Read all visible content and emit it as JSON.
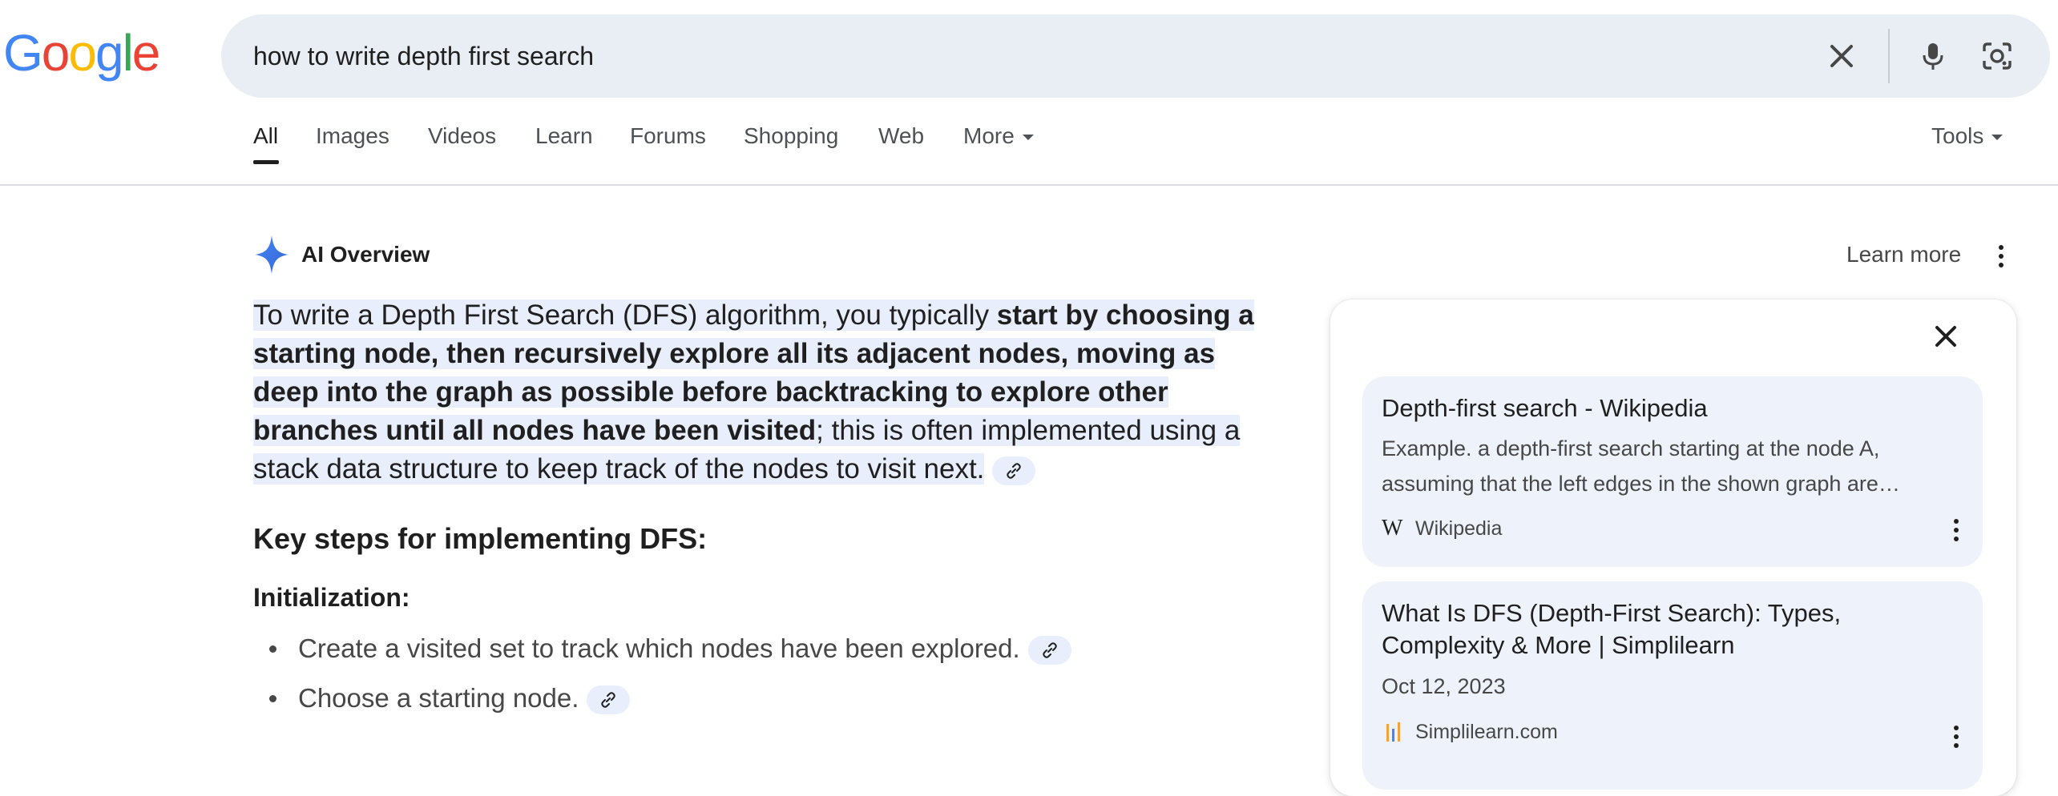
{
  "logo": {
    "letters": [
      "G",
      "o",
      "o",
      "g",
      "l",
      "e"
    ],
    "colors": [
      "#4285F4",
      "#EA4335",
      "#FBBC05",
      "#4285F4",
      "#34A853",
      "#EA4335"
    ]
  },
  "search": {
    "query": "how to write depth first search"
  },
  "tabs": [
    {
      "label": "All",
      "active": true
    },
    {
      "label": "Images"
    },
    {
      "label": "Videos"
    },
    {
      "label": "Learn"
    },
    {
      "label": "Forums"
    },
    {
      "label": "Shopping"
    },
    {
      "label": "Web"
    },
    {
      "label": "More"
    }
  ],
  "tools_label": "Tools",
  "ai_overview": {
    "title": "AI Overview",
    "learn_more": "Learn more",
    "answer_prefix": "To write a Depth First Search (DFS) algorithm, you typically ",
    "answer_bold": "start by choosing a starting node, then recursively explore all its adjacent nodes, moving as deep into the graph as possible before backtracking to explore other branches until all nodes have been visited",
    "answer_suffix": "; this is often implemented using a stack data structure to keep track of the nodes to visit next.",
    "key_steps_heading": "Key steps for implementing DFS:",
    "init_heading": "Initialization:",
    "bullets": [
      "Create a visited set to track which nodes have been explored.",
      "Choose a starting node."
    ]
  },
  "sources": [
    {
      "title": "Depth-first search - Wikipedia",
      "snippet": "Example. a depth-first search starting at the node A, assuming that the left edges in the shown graph are…",
      "site": "Wikipedia",
      "favicon": "W"
    },
    {
      "title": "What Is DFS (Depth-First Search): Types, Complexity & More | Simplilearn",
      "date": "Oct 12, 2023",
      "site": "Simplilearn.com"
    }
  ],
  "colors": {
    "accent_blue": "#4285F4",
    "highlight": "#e8eefc",
    "card_bg": "#eef2fb",
    "searchbox_bg": "#e9eef4"
  },
  "icons": [
    "close-icon",
    "microphone-icon",
    "lens-camera-icon",
    "sparkle-icon",
    "link-icon",
    "more-vert-icon"
  ]
}
